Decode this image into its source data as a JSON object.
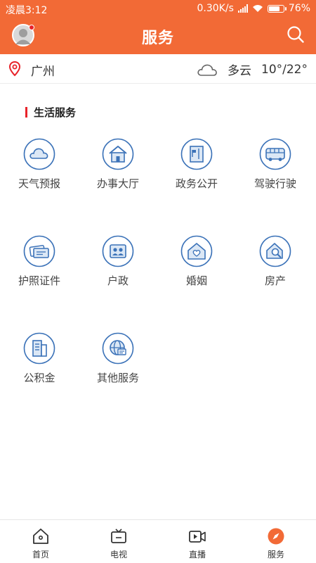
{
  "status_bar": {
    "time": "凌晨3:12",
    "speed": "0.30K/s",
    "battery": "76%"
  },
  "header": {
    "title": "服务"
  },
  "location": {
    "city": "广州",
    "weather": "多云",
    "temperature": "10°/22°"
  },
  "section": {
    "title": "生活服务"
  },
  "services": [
    {
      "label": "天气预报",
      "icon": "cloud-icon"
    },
    {
      "label": "办事大厅",
      "icon": "house-icon"
    },
    {
      "label": "政务公开",
      "icon": "document-flag-icon"
    },
    {
      "label": "驾驶行驶",
      "icon": "bus-icon"
    },
    {
      "label": "护照证件",
      "icon": "passport-icon"
    },
    {
      "label": "户政",
      "icon": "id-card-icon"
    },
    {
      "label": "婚姻",
      "icon": "heart-house-icon"
    },
    {
      "label": "房产",
      "icon": "house-search-icon"
    },
    {
      "label": "公积金",
      "icon": "building-icon"
    },
    {
      "label": "其他服务",
      "icon": "globe-icon"
    }
  ],
  "tabs": [
    {
      "label": "首页",
      "icon": "home-icon"
    },
    {
      "label": "电视",
      "icon": "tv-icon"
    },
    {
      "label": "直播",
      "icon": "live-video-icon"
    },
    {
      "label": "服务",
      "icon": "compass-icon",
      "active": true
    }
  ],
  "colors": {
    "brand": "#f26a36",
    "icon_stroke": "#3b72b8",
    "icon_fill": "#dbe7f5",
    "accent_red": "#e8232a"
  }
}
